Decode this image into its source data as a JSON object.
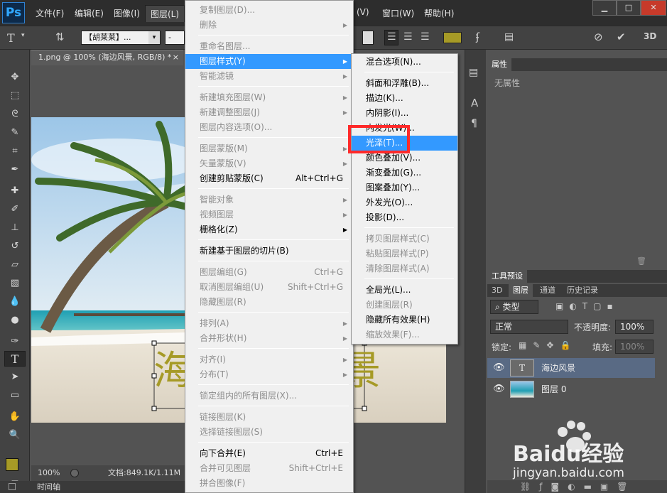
{
  "menubar": {
    "logo": "Ps",
    "items": [
      "文件(F)",
      "编辑(E)",
      "图像(I)",
      "图层(L)",
      "(V)",
      "窗口(W)",
      "帮助(H)"
    ],
    "active_index": 3,
    "window_buttons": [
      "▁",
      "□",
      "✕"
    ]
  },
  "options_bar": {
    "font_family": "【胡莱莱】...",
    "font_style": "-",
    "font_size": "T"
  },
  "document": {
    "tab_title": "1.png @ 100% (海边风景, RGB/8) *",
    "text_layer_glyphs": [
      "海",
      "景"
    ],
    "zoom": "100%",
    "doc_size": "文档:849.1K/1.11M",
    "timeline_label": "时间轴"
  },
  "layer_menu": {
    "items": [
      {
        "label": "复制图层(D)...",
        "disabled": true,
        "arrow": false,
        "shortcut": ""
      },
      {
        "label": "删除",
        "disabled": true,
        "arrow": true,
        "shortcut": ""
      },
      {
        "sep": true
      },
      {
        "label": "重命名图层...",
        "disabled": true,
        "arrow": false,
        "shortcut": ""
      },
      {
        "label": "图层样式(Y)",
        "disabled": false,
        "arrow": true,
        "shortcut": "",
        "highlight": true
      },
      {
        "label": "智能滤镜",
        "disabled": true,
        "arrow": true,
        "shortcut": ""
      },
      {
        "sep": true
      },
      {
        "label": "新建填充图层(W)",
        "disabled": true,
        "arrow": true,
        "shortcut": ""
      },
      {
        "label": "新建调整图层(J)",
        "disabled": true,
        "arrow": true,
        "shortcut": ""
      },
      {
        "label": "图层内容选项(O)...",
        "disabled": true,
        "arrow": false,
        "shortcut": ""
      },
      {
        "sep": true
      },
      {
        "label": "图层蒙版(M)",
        "disabled": true,
        "arrow": true,
        "shortcut": ""
      },
      {
        "label": "矢量蒙版(V)",
        "disabled": true,
        "arrow": true,
        "shortcut": ""
      },
      {
        "label": "创建剪贴蒙版(C)",
        "disabled": false,
        "arrow": false,
        "shortcut": "Alt+Ctrl+G"
      },
      {
        "sep": true
      },
      {
        "label": "智能对象",
        "disabled": true,
        "arrow": true,
        "shortcut": ""
      },
      {
        "label": "视频图层",
        "disabled": true,
        "arrow": true,
        "shortcut": ""
      },
      {
        "label": "栅格化(Z)",
        "disabled": false,
        "arrow": true,
        "shortcut": ""
      },
      {
        "sep": true
      },
      {
        "label": "新建基于图层的切片(B)",
        "disabled": false,
        "arrow": false,
        "shortcut": ""
      },
      {
        "sep": true
      },
      {
        "label": "图层编组(G)",
        "disabled": true,
        "arrow": false,
        "shortcut": "Ctrl+G"
      },
      {
        "label": "取消图层编组(U)",
        "disabled": true,
        "arrow": false,
        "shortcut": "Shift+Ctrl+G"
      },
      {
        "label": "隐藏图层(R)",
        "disabled": true,
        "arrow": false,
        "shortcut": ""
      },
      {
        "sep": true
      },
      {
        "label": "排列(A)",
        "disabled": true,
        "arrow": true,
        "shortcut": ""
      },
      {
        "label": "合并形状(H)",
        "disabled": true,
        "arrow": true,
        "shortcut": ""
      },
      {
        "sep": true
      },
      {
        "label": "对齐(I)",
        "disabled": true,
        "arrow": true,
        "shortcut": ""
      },
      {
        "label": "分布(T)",
        "disabled": true,
        "arrow": true,
        "shortcut": ""
      },
      {
        "sep": true
      },
      {
        "label": "锁定组内的所有图层(X)...",
        "disabled": true,
        "arrow": false,
        "shortcut": ""
      },
      {
        "sep": true
      },
      {
        "label": "链接图层(K)",
        "disabled": true,
        "arrow": false,
        "shortcut": ""
      },
      {
        "label": "选择链接图层(S)",
        "disabled": true,
        "arrow": false,
        "shortcut": ""
      },
      {
        "sep": true
      },
      {
        "label": "向下合并(E)",
        "disabled": false,
        "arrow": false,
        "shortcut": "Ctrl+E"
      },
      {
        "label": "合并可见图层",
        "disabled": true,
        "arrow": false,
        "shortcut": "Shift+Ctrl+E"
      },
      {
        "label": "拼合图像(F)",
        "disabled": true,
        "arrow": false,
        "shortcut": ""
      }
    ]
  },
  "style_submenu": {
    "items": [
      {
        "label": "混合选项(N)...",
        "disabled": false
      },
      {
        "sep": true
      },
      {
        "label": "斜面和浮雕(B)...",
        "disabled": false
      },
      {
        "label": "描边(K)...",
        "disabled": false
      },
      {
        "label": "内阴影(I)...",
        "disabled": false
      },
      {
        "label": "内发光(W)...",
        "disabled": false
      },
      {
        "label": "光泽(T)...",
        "disabled": false,
        "highlight": true
      },
      {
        "label": "颜色叠加(V)...",
        "disabled": false
      },
      {
        "label": "渐变叠加(G)...",
        "disabled": false
      },
      {
        "label": "图案叠加(Y)...",
        "disabled": false
      },
      {
        "label": "外发光(O)...",
        "disabled": false
      },
      {
        "label": "投影(D)...",
        "disabled": false
      },
      {
        "sep": true
      },
      {
        "label": "拷贝图层样式(C)",
        "disabled": true
      },
      {
        "label": "粘贴图层样式(P)",
        "disabled": true
      },
      {
        "label": "清除图层样式(A)",
        "disabled": true
      },
      {
        "sep": true
      },
      {
        "label": "全局光(L)...",
        "disabled": false
      },
      {
        "label": "创建图层(R)",
        "disabled": true
      },
      {
        "label": "隐藏所有效果(H)",
        "disabled": false
      },
      {
        "label": "缩放效果(F)...",
        "disabled": true
      }
    ]
  },
  "properties_panel": {
    "tab": "属性",
    "empty_text": "无属性"
  },
  "tool_presets": {
    "tab": "工具预设"
  },
  "layers_panel": {
    "tabs": [
      "3D",
      "图层",
      "通道",
      "历史记录"
    ],
    "active_tab": 1,
    "filter_label": "类型",
    "blend_mode": "正常",
    "opacity_label": "不透明度:",
    "opacity_value": "100%",
    "lock_label": "锁定:",
    "fill_label": "填充:",
    "fill_value": "100%",
    "layers": [
      {
        "name": "海边风景",
        "kind": "text",
        "selected": true
      },
      {
        "name": "图层 0",
        "kind": "image",
        "selected": false
      }
    ]
  },
  "watermark": {
    "brand": "Baidu经验",
    "url": "jingyan.baidu.com"
  },
  "colors": {
    "accent_highlight": "#3399ff",
    "annotation_box": "#ff2a2a",
    "text_color": "#a69a26"
  }
}
